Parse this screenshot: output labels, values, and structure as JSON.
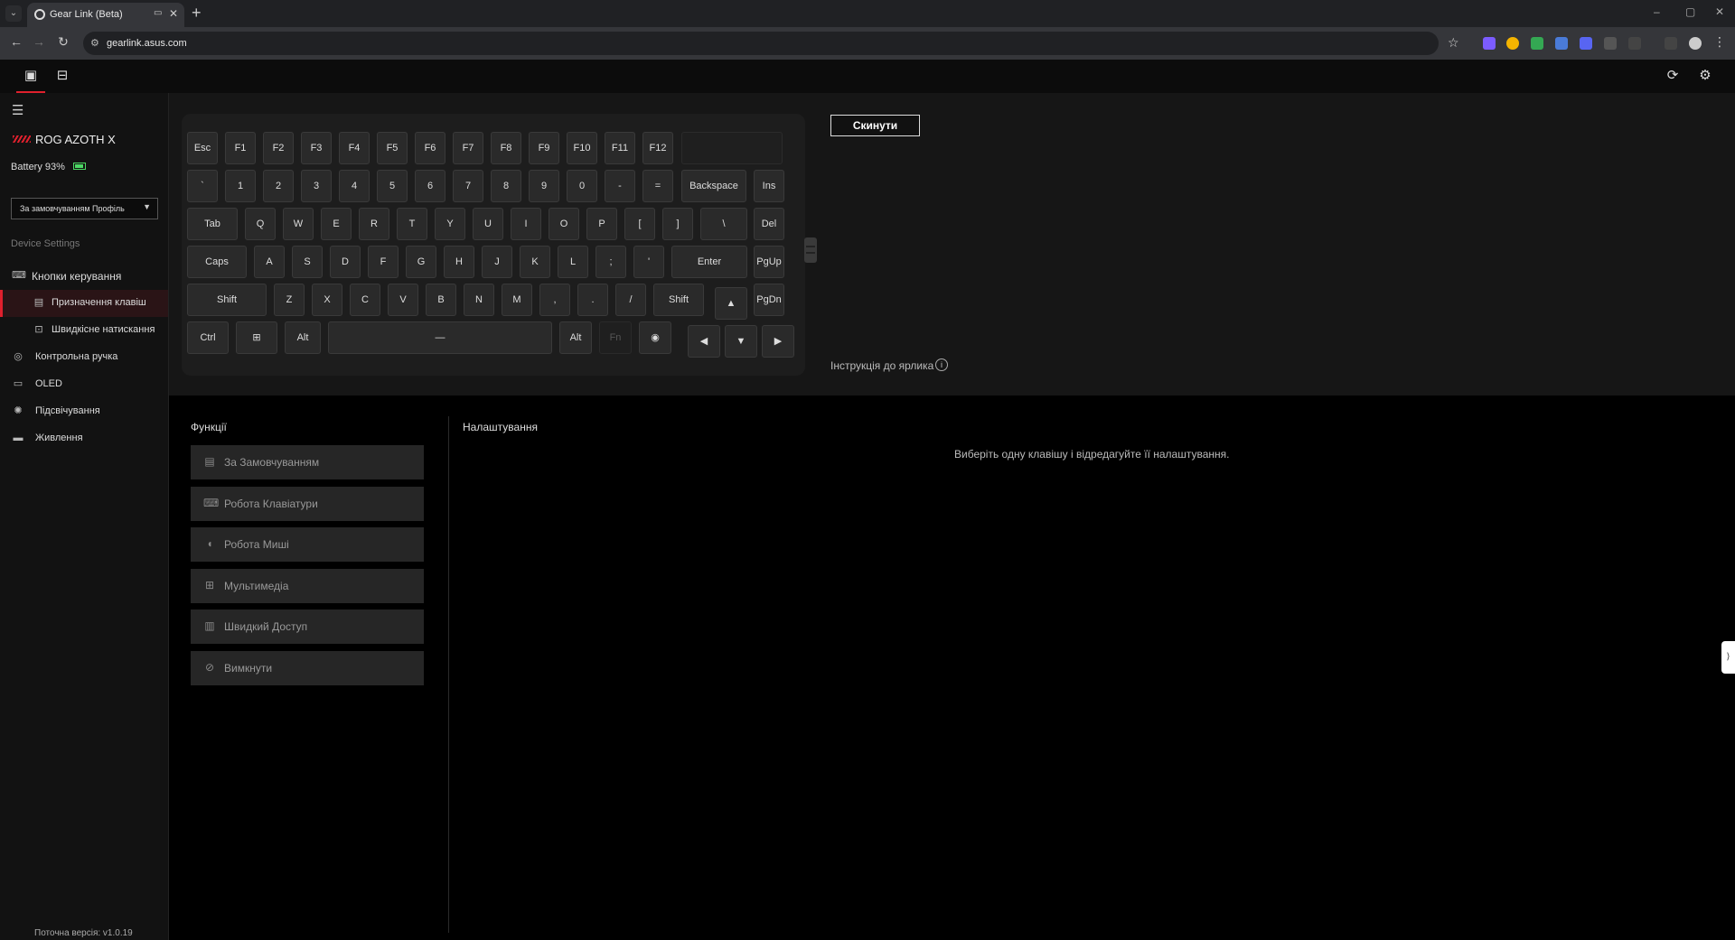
{
  "browser": {
    "tab_title": "Gear Link (Beta)",
    "new_tab": "+",
    "url": "gearlink.asus.com",
    "window_controls": [
      "–",
      "▢",
      "✕"
    ]
  },
  "sidebar": {
    "device_name": "ROG AZOTH X",
    "battery_text": "Battery 93%",
    "battery_level": 0.93,
    "profile": "За замовчуванням Профіль",
    "section_label": "Device Settings",
    "items": [
      {
        "label": "Кнопки керування",
        "icon": "keyboard-icon"
      },
      {
        "label": "Призначення клавіш",
        "icon": "key-assign-icon"
      },
      {
        "label": "Швидкісне натискання",
        "icon": "rapid-trigger-icon"
      },
      {
        "label": "Контрольна ручка",
        "icon": "knob-icon"
      },
      {
        "label": "OLED",
        "icon": "oled-icon"
      },
      {
        "label": "Підсвічування",
        "icon": "lighting-icon"
      },
      {
        "label": "Живлення",
        "icon": "power-icon"
      }
    ],
    "version": "Поточна версія: v1.0.19"
  },
  "keyboard": {
    "rows": [
      [
        "Esc",
        "F1",
        "F2",
        "F3",
        "F4",
        "F5",
        "F6",
        "F7",
        "F8",
        "F9",
        "F10",
        "F11",
        "F12",
        ""
      ],
      [
        "`",
        "1",
        "2",
        "3",
        "4",
        "5",
        "6",
        "7",
        "8",
        "9",
        "0",
        "-",
        "=",
        "Backspace",
        "Ins"
      ],
      [
        "Tab",
        "Q",
        "W",
        "E",
        "R",
        "T",
        "Y",
        "U",
        "I",
        "O",
        "P",
        "[",
        "]",
        "\\",
        "Del"
      ],
      [
        "Caps",
        "A",
        "S",
        "D",
        "F",
        "G",
        "H",
        "J",
        "K",
        "L",
        ";",
        "'",
        "Enter",
        "PgUp"
      ],
      [
        "Shift",
        "Z",
        "X",
        "C",
        "V",
        "B",
        "N",
        "M",
        ",",
        ".",
        "/",
        "Shift",
        "▲",
        "PgDn"
      ],
      [
        "Ctrl",
        "⊞",
        "Alt",
        "—",
        "Alt",
        "Fn",
        "◉",
        "◀",
        "▼",
        "▶"
      ]
    ]
  },
  "actions": {
    "reset": "Скинути",
    "shortcut_guide": "Інструкція до ярлика",
    "info": "i"
  },
  "functions": {
    "title": "Функції",
    "items": [
      {
        "label": "За Замовчуванням",
        "icon": "default-icon"
      },
      {
        "label": "Робота Клавіатури",
        "icon": "keyboard-icon"
      },
      {
        "label": "Робота Миші",
        "icon": "mouse-icon"
      },
      {
        "label": "Мультимедіа",
        "icon": "multimedia-icon"
      },
      {
        "label": "Швидкий Доступ",
        "icon": "shortcut-icon"
      },
      {
        "label": "Вимкнути",
        "icon": "disable-icon"
      }
    ]
  },
  "settings": {
    "title": "Налаштування",
    "hint": "Виберіть одну клавішу і відредагуйте її налаштування."
  }
}
